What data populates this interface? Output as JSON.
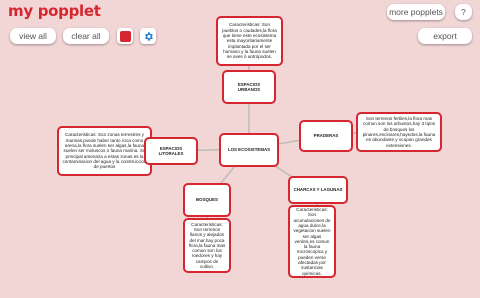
{
  "app": {
    "title": "my popplet"
  },
  "toolbar": {
    "view_all": "view all",
    "clear_all": "clear all",
    "more_popplets": "more popplets",
    "help": "?",
    "export": "export"
  },
  "colors": {
    "accent": "#d6262f",
    "background": "#f2d5d5",
    "connector": "#bbbbbb",
    "gear": "#2b7fd1"
  },
  "nodes": {
    "center": "LOS ECOSISTEMAS",
    "urbanos": "ESPACIOS URBANOS",
    "urbanos_desc": "Caracteristicas: Son pueblos o ciudades,la flora que tiene este ecosistema esta mayoritariamente implantada por el ser humano y la fauna suelen se aves ò antrópodos.",
    "litorales": "ESPACIOS LITORALES",
    "litorales_desc": "Caracteristicas: Son zonas terrestres y marinas,puede haber tanto roca como arena,la flora suelen ser algas,la fauna suelen ser moluscos o fauna marina. Su principal amenaza a estas zonas es la contaminacion del agua y la construccion de puertos",
    "praderas": "PRADERAS",
    "praderas_desc": "Son terrenos fertiles,la flora mas comun son los arbustos,hay 3 tipos de bosques los pinares,encinares,hayedos,la fauna es abundante y ocupan grandes extensiones.",
    "bosques": "BOSQUES",
    "bosques_desc": "Caracteristicas: Son terrenos llanos y alejados del mar,hay poca flora,la fauna mas comun son los roedores y hay campos de cultivo.",
    "charcas": "CHARCAS Y LAGUNAS",
    "charcas_desc": "Caracteristicas: Son acumulaciones de agua dulce,la vegetacion suelen ser algas verdes,es comun la fauna microscopica y pueden verse afectadas por sustancias químicas."
  }
}
